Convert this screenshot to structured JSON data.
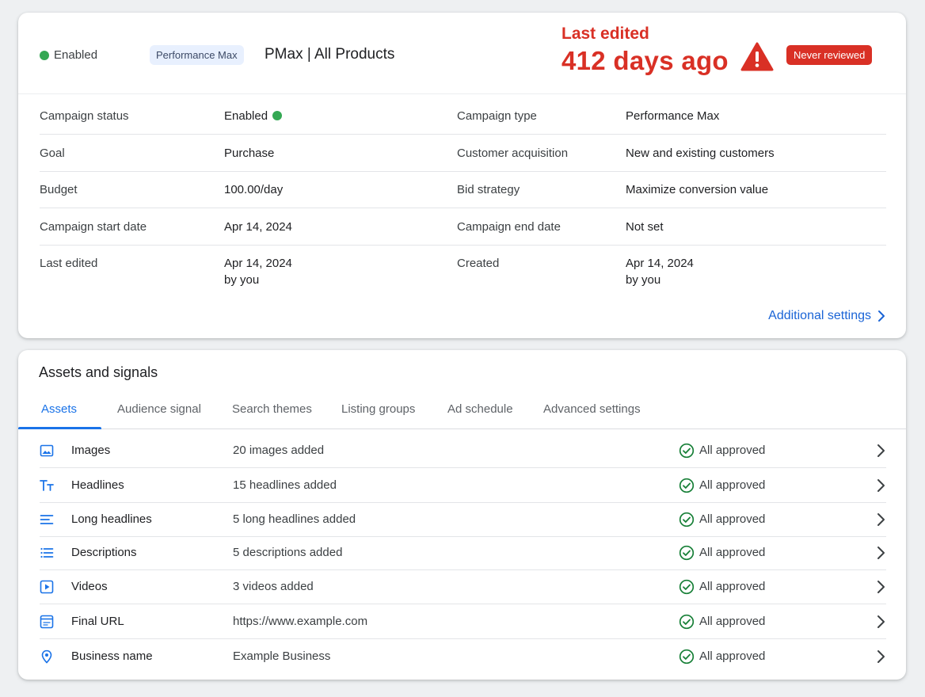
{
  "header": {
    "status": "Enabled",
    "campaign_type_chip": "Performance Max",
    "campaign_name": "PMax | All Products",
    "last_edited_label": "Last edited",
    "last_edited_value": "412 days ago",
    "review_badge": "Never reviewed"
  },
  "details": [
    {
      "label1": "Campaign status",
      "value1": "Enabled",
      "label2": "Campaign type",
      "value2": "Performance Max"
    },
    {
      "label1": "Goal",
      "value1": "Purchase",
      "label2": "Customer acquisition",
      "value2": "New and existing customers"
    },
    {
      "label1": "Budget",
      "value1": "100.00/day",
      "label2": "Bid strategy",
      "value2": "Maximize conversion value"
    },
    {
      "label1": "Campaign start date",
      "value1": "Apr 14, 2024",
      "label2": "Campaign end date",
      "value2": "Not set"
    },
    {
      "label1": "Last edited",
      "value1": "Apr 14, 2024",
      "value1_sub": "by you",
      "label2": "Created",
      "value2": "Apr 14, 2024",
      "value2_sub": "by you"
    }
  ],
  "additional_settings_label": "Additional settings",
  "assets_section": {
    "title": "Assets and signals",
    "tabs": [
      "Assets",
      "Audience signal",
      "Search themes",
      "Listing groups",
      "Ad schedule",
      "Advanced settings"
    ],
    "rows": [
      {
        "icon": "image-icon",
        "name": "Images",
        "count": "20 images added",
        "status": "All approved"
      },
      {
        "icon": "text-size-icon",
        "name": "Headlines",
        "count": "15 headlines added",
        "status": "All approved"
      },
      {
        "icon": "long-text-icon",
        "name": "Long headlines",
        "count": "5 long headlines added",
        "status": "All approved"
      },
      {
        "icon": "list-icon",
        "name": "Descriptions",
        "count": "5 descriptions added",
        "status": "All approved"
      },
      {
        "icon": "video-icon",
        "name": "Videos",
        "count": "3 videos added",
        "status": "All approved"
      },
      {
        "icon": "web-page-icon",
        "name": "Final URL",
        "count": "https://www.example.com",
        "status": "All approved"
      },
      {
        "icon": "location-pin-icon",
        "name": "Business name",
        "count": "Example Business",
        "status": "All approved"
      }
    ]
  },
  "colors": {
    "enabled": "#34a853",
    "alert": "#d93025",
    "link": "#1a73e8",
    "approved": "#188038"
  }
}
